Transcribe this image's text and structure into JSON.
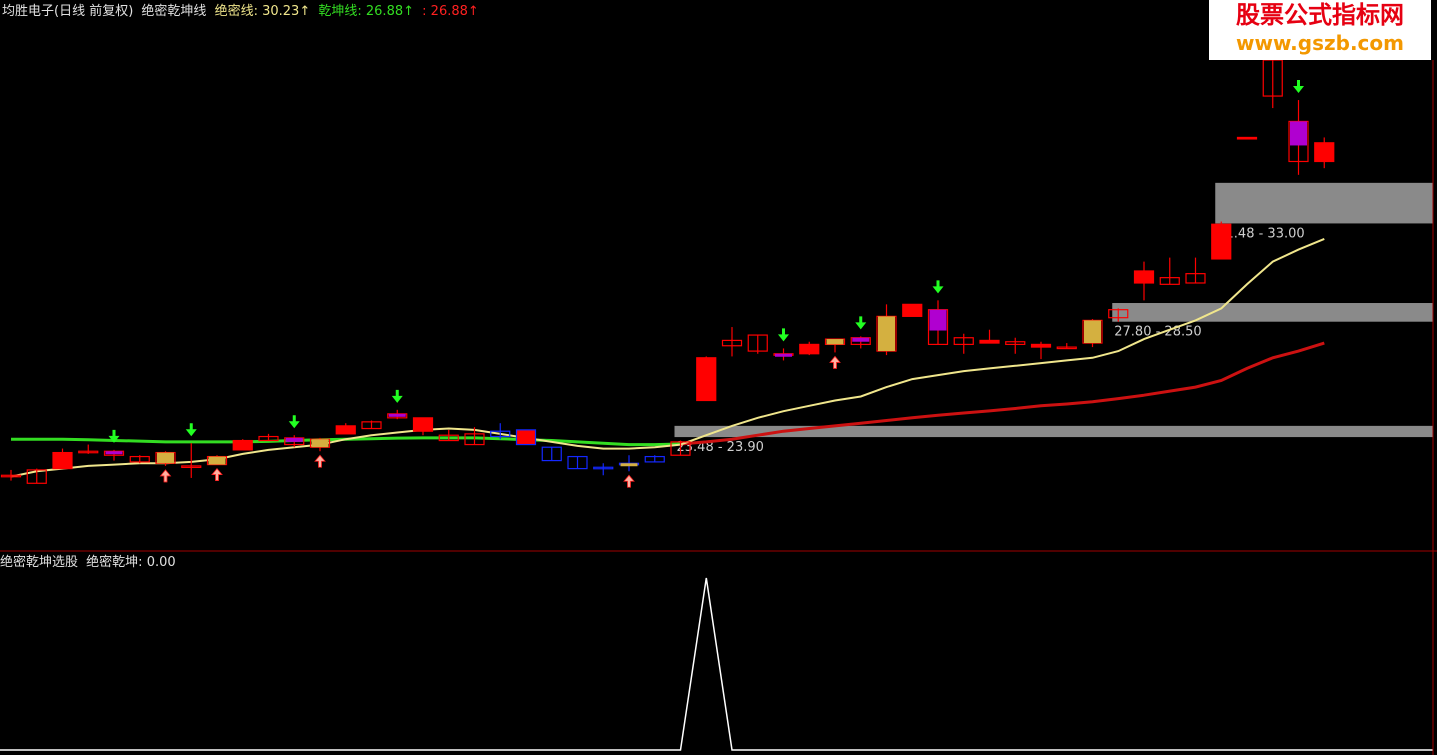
{
  "header": {
    "title": "均胜电子(日线 前复权)",
    "indicator_name": "绝密乾坤线",
    "series_1_label": "绝密线:",
    "series_1_value": "30.23↑",
    "series_2_label": "乾坤线:",
    "series_2_value": "26.88↑",
    "series_3_label": ":",
    "series_3_value": "26.88↑"
  },
  "sub_header": {
    "title": "绝密乾坤选股",
    "label": "绝密乾坤:",
    "value": "0.00"
  },
  "watermark": {
    "line1": "股票公式指标网",
    "line2": "www.gszb.com"
  },
  "colors": {
    "background": "#000000",
    "up": "#ff0000",
    "down": "#1428ff",
    "jm_line": "#f0e68c",
    "qk_line_up": "#cc1111",
    "qk_line_flat": "#33dd22",
    "zone": "#8a8a8a",
    "purple": "#b000d0",
    "arrow_down": "#22ff22",
    "border": "#a00000",
    "signal": "#ffffff"
  },
  "chart_data": [
    {
      "type": "candlestick",
      "ylim": [
        20.3,
        37.6
      ],
      "candles": [
        {
          "o": 22.05,
          "h": 22.25,
          "l": 21.85,
          "c": 22.05,
          "hl": "none",
          "mk": "none"
        },
        {
          "o": 21.75,
          "h": 22.3,
          "l": 21.75,
          "c": 22.25,
          "hl": "none",
          "mk": "none"
        },
        {
          "o": 22.3,
          "h": 23.05,
          "l": 22.3,
          "c": 22.9,
          "hl": "none",
          "mk": "none"
        },
        {
          "o": 22.95,
          "h": 23.2,
          "l": 22.85,
          "c": 22.95,
          "hl": "none",
          "mk": "none"
        },
        {
          "o": 22.8,
          "h": 23.0,
          "l": 22.6,
          "c": 22.95,
          "hl": "purple",
          "mk": "down"
        },
        {
          "o": 22.55,
          "h": 22.8,
          "l": 22.5,
          "c": 22.75,
          "hl": "none",
          "mk": "none"
        },
        {
          "o": 22.5,
          "h": 22.95,
          "l": 22.4,
          "c": 22.9,
          "hl": "gold",
          "mk": "up"
        },
        {
          "o": 22.4,
          "h": 23.25,
          "l": 21.95,
          "c": 22.4,
          "hl": "none",
          "mk": "down"
        },
        {
          "o": 22.45,
          "h": 22.8,
          "l": 22.45,
          "c": 22.75,
          "hl": "gold",
          "mk": "up"
        },
        {
          "o": 23.0,
          "h": 23.4,
          "l": 23.0,
          "c": 23.35,
          "hl": "none",
          "mk": "none"
        },
        {
          "o": 23.35,
          "h": 23.6,
          "l": 23.35,
          "c": 23.5,
          "hl": "none",
          "mk": "none"
        },
        {
          "o": 23.2,
          "h": 23.55,
          "l": 23.1,
          "c": 23.45,
          "hl": "purple",
          "mk": "down"
        },
        {
          "o": 23.1,
          "h": 23.45,
          "l": 22.95,
          "c": 23.4,
          "hl": "gold",
          "mk": "up"
        },
        {
          "o": 23.6,
          "h": 24.0,
          "l": 23.6,
          "c": 23.9,
          "hl": "none",
          "mk": "none"
        },
        {
          "o": 23.8,
          "h": 24.1,
          "l": 23.8,
          "c": 24.05,
          "hl": "none",
          "mk": "none"
        },
        {
          "o": 24.2,
          "h": 24.5,
          "l": 24.15,
          "c": 24.35,
          "hl": "purple",
          "mk": "down"
        },
        {
          "o": 24.2,
          "h": 24.2,
          "l": 23.55,
          "c": 23.7,
          "hl": "none",
          "mk": "none"
        },
        {
          "o": 23.35,
          "h": 23.75,
          "l": 23.35,
          "c": 23.55,
          "hl": "none",
          "mk": "none"
        },
        {
          "o": 23.2,
          "h": 23.85,
          "l": 23.2,
          "c": 23.6,
          "hl": "none",
          "mk": "none"
        },
        {
          "o": 23.7,
          "h": 24.0,
          "l": 23.4,
          "c": 23.5,
          "hl": "none",
          "mk": "none"
        },
        {
          "o": 23.75,
          "h": 23.75,
          "l": 23.2,
          "c": 23.2,
          "hl": "none",
          "mk": "none"
        },
        {
          "o": 23.1,
          "h": 23.1,
          "l": 22.6,
          "c": 22.6,
          "hl": "none",
          "mk": "none"
        },
        {
          "o": 22.75,
          "h": 22.75,
          "l": 22.3,
          "c": 22.3,
          "hl": "none",
          "mk": "none"
        },
        {
          "o": 22.35,
          "h": 22.5,
          "l": 22.05,
          "c": 22.3,
          "hl": "none",
          "mk": "none"
        },
        {
          "o": 22.5,
          "h": 22.8,
          "l": 22.2,
          "c": 22.45,
          "hl": "gold",
          "mk": "up"
        },
        {
          "o": 22.75,
          "h": 22.8,
          "l": 22.55,
          "c": 22.55,
          "hl": "none",
          "mk": "none"
        },
        {
          "o": 22.8,
          "h": 23.35,
          "l": 22.8,
          "c": 23.3,
          "hl": "none",
          "mk": "none"
        },
        {
          "o": 24.85,
          "h": 26.5,
          "l": 24.85,
          "c": 26.45,
          "hl": "none",
          "mk": "none"
        },
        {
          "o": 26.9,
          "h": 27.6,
          "l": 26.5,
          "c": 27.1,
          "hl": "none",
          "mk": "none"
        },
        {
          "o": 26.7,
          "h": 27.3,
          "l": 26.6,
          "c": 27.3,
          "hl": "none",
          "mk": "none"
        },
        {
          "o": 26.6,
          "h": 26.8,
          "l": 26.35,
          "c": 26.6,
          "hl": "purple",
          "mk": "down"
        },
        {
          "o": 26.6,
          "h": 27.05,
          "l": 26.55,
          "c": 26.95,
          "hl": "none",
          "mk": "none"
        },
        {
          "o": 26.95,
          "h": 27.1,
          "l": 26.65,
          "c": 27.15,
          "hl": "gold",
          "mk": "up"
        },
        {
          "o": 26.95,
          "h": 27.25,
          "l": 26.8,
          "c": 27.2,
          "hl": "purple",
          "mk": "down"
        },
        {
          "o": 26.7,
          "h": 28.45,
          "l": 26.55,
          "c": 28.0,
          "hl": "gold",
          "mk": "none"
        },
        {
          "o": 28.0,
          "h": 28.45,
          "l": 28.0,
          "c": 28.45,
          "hl": "none",
          "mk": "none"
        },
        {
          "o": 26.95,
          "h": 28.6,
          "l": 26.95,
          "c": 28.25,
          "hl": "purple",
          "mk": "down"
        },
        {
          "o": 26.95,
          "h": 27.35,
          "l": 26.6,
          "c": 27.2,
          "hl": "none",
          "mk": "none"
        },
        {
          "o": 27.1,
          "h": 27.5,
          "l": 27.0,
          "c": 27.0,
          "hl": "none",
          "mk": "none"
        },
        {
          "o": 26.95,
          "h": 27.2,
          "l": 26.6,
          "c": 27.05,
          "hl": "none",
          "mk": "none"
        },
        {
          "o": 26.95,
          "h": 27.05,
          "l": 26.4,
          "c": 26.85,
          "hl": "none",
          "mk": "none"
        },
        {
          "o": 26.85,
          "h": 27.0,
          "l": 26.8,
          "c": 26.85,
          "hl": "none",
          "mk": "none"
        },
        {
          "o": 27.0,
          "h": 27.9,
          "l": 26.85,
          "c": 27.85,
          "hl": "gold",
          "mk": "none"
        },
        {
          "o": 27.95,
          "h": 28.3,
          "l": 27.8,
          "c": 28.25,
          "hl": "none",
          "mk": "none"
        },
        {
          "o": 29.7,
          "h": 30.05,
          "l": 28.6,
          "c": 29.25,
          "hl": "none",
          "mk": "none"
        },
        {
          "o": 29.2,
          "h": 30.2,
          "l": 29.2,
          "c": 29.45,
          "hl": "none",
          "mk": "none"
        },
        {
          "o": 29.25,
          "h": 30.2,
          "l": 29.25,
          "c": 29.6,
          "hl": "none",
          "mk": "none"
        },
        {
          "o": 30.15,
          "h": 31.55,
          "l": 30.15,
          "c": 31.45,
          "hl": "none",
          "mk": "none"
        },
        {
          "o": 34.7,
          "h": 34.7,
          "l": 34.7,
          "c": 34.7,
          "hl": "none",
          "mk": "none"
        },
        {
          "o": 36.25,
          "h": 37.6,
          "l": 35.8,
          "c": 37.6,
          "hl": "none",
          "mk": "none"
        },
        {
          "o": 33.8,
          "h": 36.1,
          "l": 33.3,
          "c": 35.3,
          "hl": "purple",
          "mk": "down"
        },
        {
          "o": 33.8,
          "h": 34.7,
          "l": 33.55,
          "c": 34.5,
          "hl": "none",
          "mk": "none"
        }
      ],
      "jm_line": [
        22.0,
        22.2,
        22.3,
        22.4,
        22.45,
        22.5,
        22.5,
        22.55,
        22.65,
        22.85,
        23.0,
        23.1,
        23.2,
        23.4,
        23.55,
        23.65,
        23.75,
        23.8,
        23.75,
        23.6,
        23.45,
        23.3,
        23.15,
        23.05,
        23.05,
        23.1,
        23.2,
        23.55,
        23.9,
        24.2,
        24.45,
        24.65,
        24.85,
        25.0,
        25.35,
        25.65,
        25.8,
        25.95,
        26.05,
        26.15,
        26.25,
        26.35,
        26.45,
        26.7,
        27.15,
        27.5,
        27.85,
        28.3,
        29.2,
        30.05,
        30.5,
        30.9
      ],
      "qk_line": [
        23.4,
        23.4,
        23.4,
        23.38,
        23.35,
        23.33,
        23.3,
        23.3,
        23.3,
        23.3,
        23.32,
        23.35,
        23.38,
        23.4,
        23.42,
        23.44,
        23.45,
        23.45,
        23.45,
        23.42,
        23.38,
        23.35,
        23.3,
        23.25,
        23.2,
        23.2,
        23.22,
        23.3,
        23.4,
        23.55,
        23.7,
        23.8,
        23.9,
        24.0,
        24.1,
        24.2,
        24.3,
        24.38,
        24.46,
        24.55,
        24.65,
        24.72,
        24.8,
        24.92,
        25.05,
        25.2,
        25.35,
        25.6,
        26.05,
        26.45,
        26.7,
        27.0
      ],
      "qk_flat_until": 26,
      "zones": [
        {
          "lo": 23.48,
          "hi": 23.9,
          "label": "23.48 - 23.90",
          "from": 26
        },
        {
          "lo": 27.8,
          "hi": 28.5,
          "label": "27.80 - 28.50",
          "from": 43
        },
        {
          "lo": 31.48,
          "hi": 33.0,
          "label": "31.48 - 33.00",
          "from": 47
        }
      ]
    },
    {
      "type": "line",
      "name": "绝密乾坤",
      "ylim": [
        0,
        1
      ],
      "values": [
        0,
        0,
        0,
        0,
        0,
        0,
        0,
        0,
        0,
        0,
        0,
        0,
        0,
        0,
        0,
        0,
        0,
        0,
        0,
        0,
        0,
        0,
        0,
        0,
        0,
        0,
        0,
        1,
        0,
        0,
        0,
        0,
        0,
        0,
        0,
        0,
        0,
        0,
        0,
        0,
        0,
        0,
        0,
        0,
        0,
        0,
        0,
        0,
        0,
        0,
        0,
        0
      ]
    }
  ]
}
